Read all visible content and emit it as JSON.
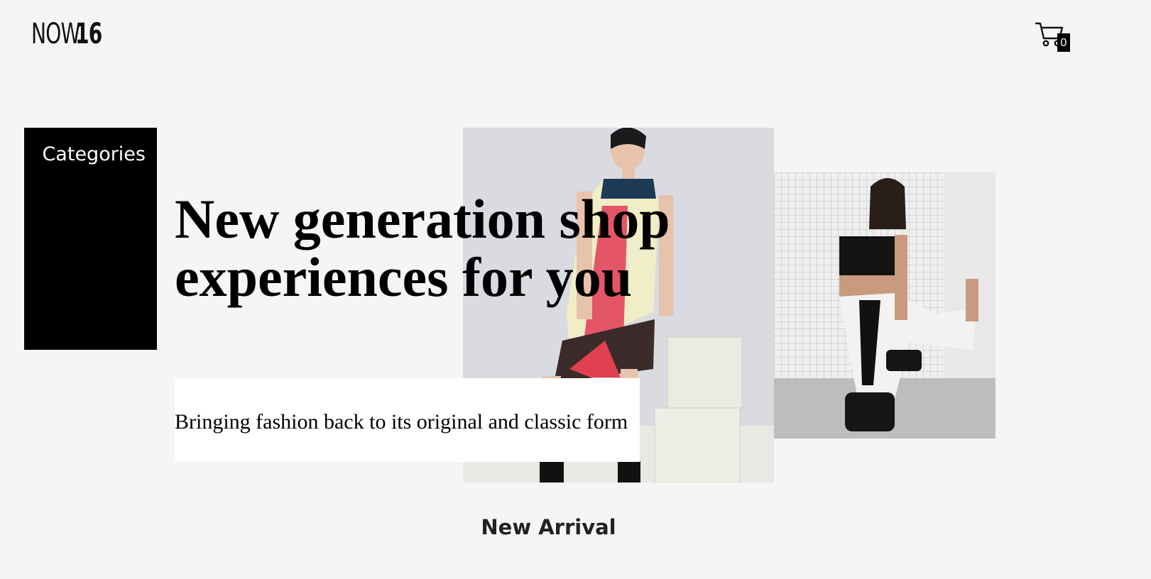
{
  "header": {
    "logo_light": "NOW",
    "logo_bold": "16",
    "cart_count": "0"
  },
  "sidebar": {
    "categories_label": "Categories"
  },
  "hero": {
    "headline": "New generation shop experiences for you",
    "tagline": "Bringing fashion back to its original and classic form"
  },
  "section": {
    "new_arrival_title": "New Arrival"
  },
  "colors": {
    "background": "#f5f5f5",
    "categories_panel": "#000000",
    "tagline_box": "#ffffff"
  }
}
